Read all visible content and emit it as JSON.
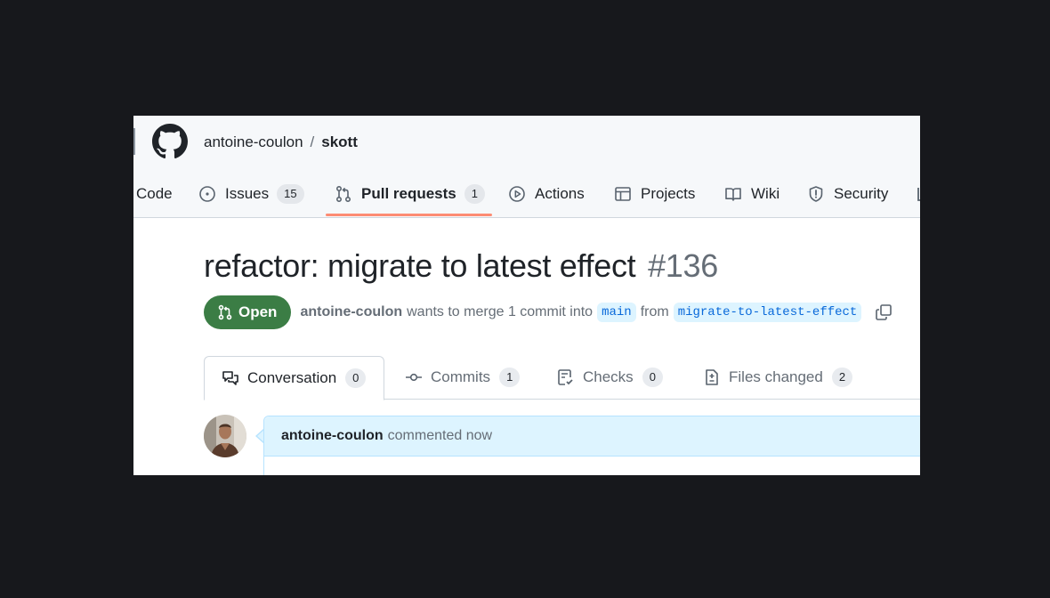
{
  "repo": {
    "owner": "antoine-coulon",
    "separator": "/",
    "name": "skott"
  },
  "nav": {
    "code": {
      "label": "Code"
    },
    "issues": {
      "label": "Issues",
      "count": "15"
    },
    "pulls": {
      "label": "Pull requests",
      "count": "1"
    },
    "actions": {
      "label": "Actions"
    },
    "projects": {
      "label": "Projects"
    },
    "wiki": {
      "label": "Wiki"
    },
    "security": {
      "label": "Security"
    }
  },
  "pr": {
    "title": "refactor: migrate to latest effect",
    "number": "#136",
    "state": "Open",
    "author": "antoine-coulon",
    "merge_text": "wants to merge 1 commit into",
    "base_branch": "main",
    "from_text": "from",
    "head_branch": "migrate-to-latest-effect"
  },
  "pr_tabs": {
    "conversation": {
      "label": "Conversation",
      "count": "0"
    },
    "commits": {
      "label": "Commits",
      "count": "1"
    },
    "checks": {
      "label": "Checks",
      "count": "0"
    },
    "files": {
      "label": "Files changed",
      "count": "2"
    }
  },
  "comment": {
    "author": "antoine-coulon",
    "action": "commented now"
  },
  "colors": {
    "open_green": "#3b7d45",
    "active_underline": "#fd8c73",
    "link_blue": "#0969da",
    "comment_header_bg": "#ddf4ff"
  }
}
